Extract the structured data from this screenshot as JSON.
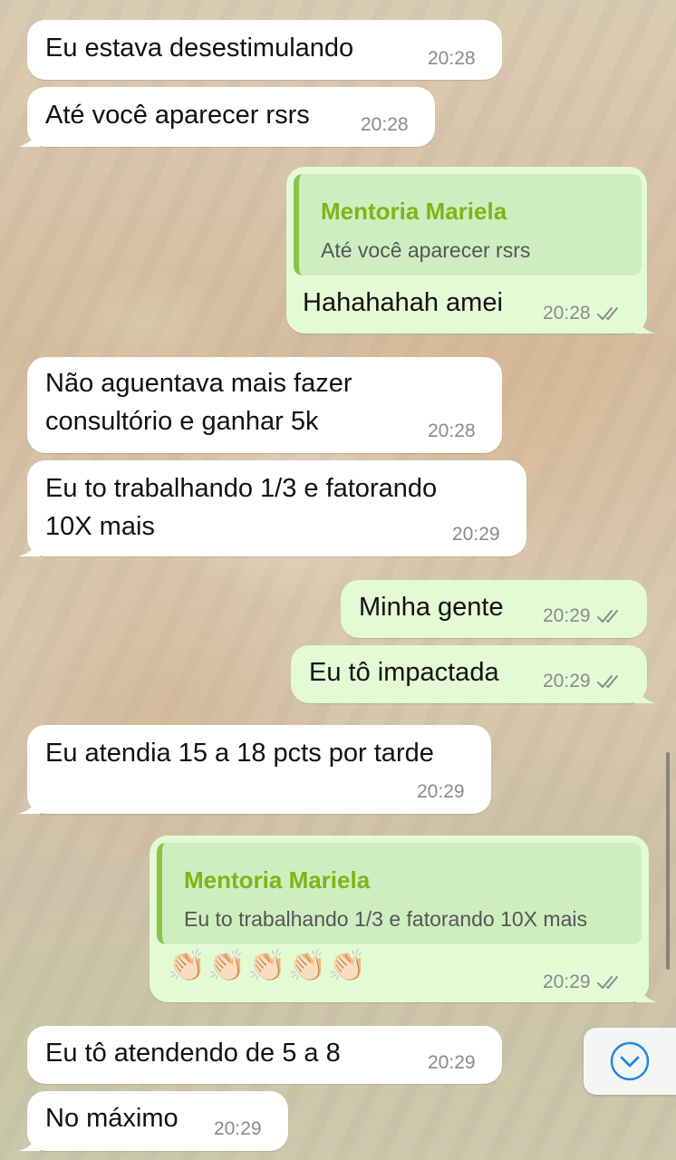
{
  "messages": [
    {
      "id": "m1",
      "direction": "incoming",
      "text": "Eu estava desestimulando",
      "time": "20:28"
    },
    {
      "id": "m2",
      "direction": "incoming",
      "text": "Até você aparecer rsrs",
      "time": "20:28"
    },
    {
      "id": "m3",
      "direction": "outgoing",
      "quote": {
        "author": "Mentoria Mariela",
        "text": "Até você aparecer rsrs"
      },
      "text": "Hahahahah amei",
      "time": "20:28",
      "status": "read"
    },
    {
      "id": "m4",
      "direction": "incoming",
      "lines": [
        "Não aguentava mais fazer",
        "consultório e ganhar 5k"
      ],
      "time": "20:28"
    },
    {
      "id": "m5",
      "direction": "incoming",
      "lines": [
        "Eu to trabalhando 1/3 e fatorando",
        "10X mais"
      ],
      "time": "20:29"
    },
    {
      "id": "m6",
      "direction": "outgoing",
      "text": "Minha gente",
      "time": "20:29",
      "status": "read"
    },
    {
      "id": "m7",
      "direction": "outgoing",
      "text": "Eu tô impactada",
      "time": "20:29",
      "status": "read"
    },
    {
      "id": "m8",
      "direction": "incoming",
      "text": "Eu atendia 15 a 18 pcts por tarde",
      "time": "20:29"
    },
    {
      "id": "m9",
      "direction": "outgoing",
      "quote": {
        "author": "Mentoria Mariela",
        "text": "Eu to trabalhando 1/3 e fatorando 10X mais"
      },
      "text": "👏🏻👏🏻👏🏻👏🏻👏🏻",
      "time": "20:29",
      "status": "read"
    },
    {
      "id": "m10",
      "direction": "incoming",
      "text": "Eu tô atendendo de 5 a 8",
      "time": "20:29"
    },
    {
      "id": "m11",
      "direction": "incoming",
      "text": "No máximo",
      "time": "20:29"
    }
  ],
  "icons": {
    "read_ticks": "double-check-icon",
    "scroll_down": "chevron-down-circle-icon"
  },
  "colors": {
    "incoming_bubble": "#ffffff",
    "outgoing_bubble": "#e2fbd4",
    "quote_author": "#7cb518",
    "quote_bar": "#8bc34a",
    "scroll_icon": "#1e88e5"
  }
}
